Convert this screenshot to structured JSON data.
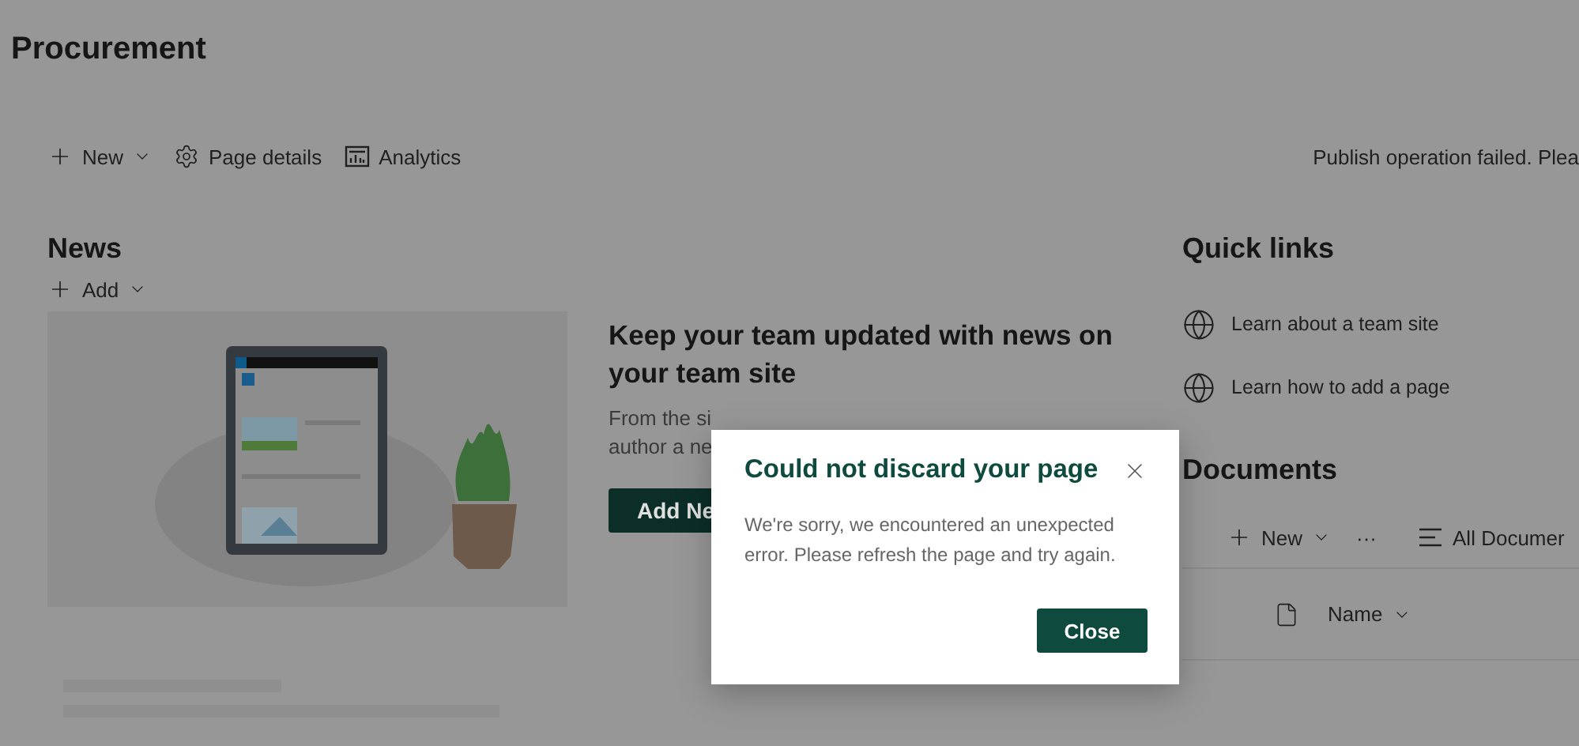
{
  "page": {
    "title": "Procurement"
  },
  "command_bar": {
    "items": [
      {
        "kind": "new",
        "label": "New"
      },
      {
        "kind": "details",
        "label": "Page details"
      },
      {
        "kind": "analytics",
        "label": "Analytics"
      }
    ],
    "status_message": "Publish operation failed. Plea"
  },
  "news": {
    "title": "News",
    "add_label": "Add",
    "hero": {
      "kind": "picture",
      "heading": "Keep your team updated with news on your team site",
      "body_lines": [
        "From the si",
        "author a ne"
      ],
      "button": "Add Ne"
    }
  },
  "quick_links": {
    "title": "Quick links",
    "items": [
      "Learn about a team site",
      "Learn how to add a page"
    ]
  },
  "documents": {
    "title": "Documents",
    "new_label": "New",
    "more_label": "···",
    "view_label": "All Documer",
    "columns": [
      "Name"
    ]
  },
  "dialog": {
    "title": "Could not discard your page",
    "message": "We're sorry, we encountered an unexpected error. Please refresh the page and try again.",
    "close_button": "Close"
  }
}
